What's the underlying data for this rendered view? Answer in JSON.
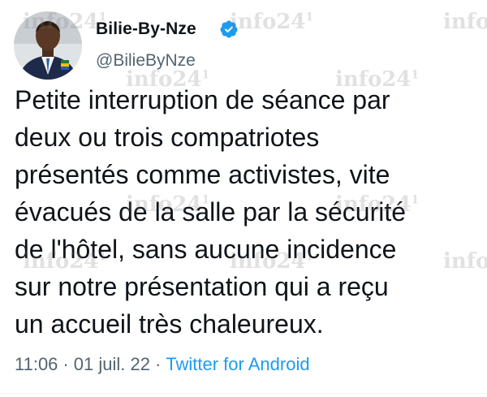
{
  "tweet": {
    "author": {
      "display_name": "Bilie-By-Nze",
      "handle": "@BilieByNze",
      "verified_icon": "verified-badge-icon"
    },
    "text_lines": [
      "Petite interruption de séance par",
      "deux ou trois compatriotes",
      "présentés comme activistes, vite",
      "évacués de la salle par la sécurité",
      "de l'hôtel, sans aucune incidence",
      "sur notre présentation qui a reçu",
      "un accueil très chaleureux."
    ],
    "meta": {
      "time": "11:06",
      "separator": "·",
      "date": "01 juil. 22",
      "source": "Twitter for Android"
    }
  },
  "watermark": {
    "text": "info241",
    "color": "#787878"
  },
  "colors": {
    "text": "#0f1419",
    "secondary": "#536471",
    "link": "#1d9bf0",
    "verified": "#1d9bf0"
  }
}
